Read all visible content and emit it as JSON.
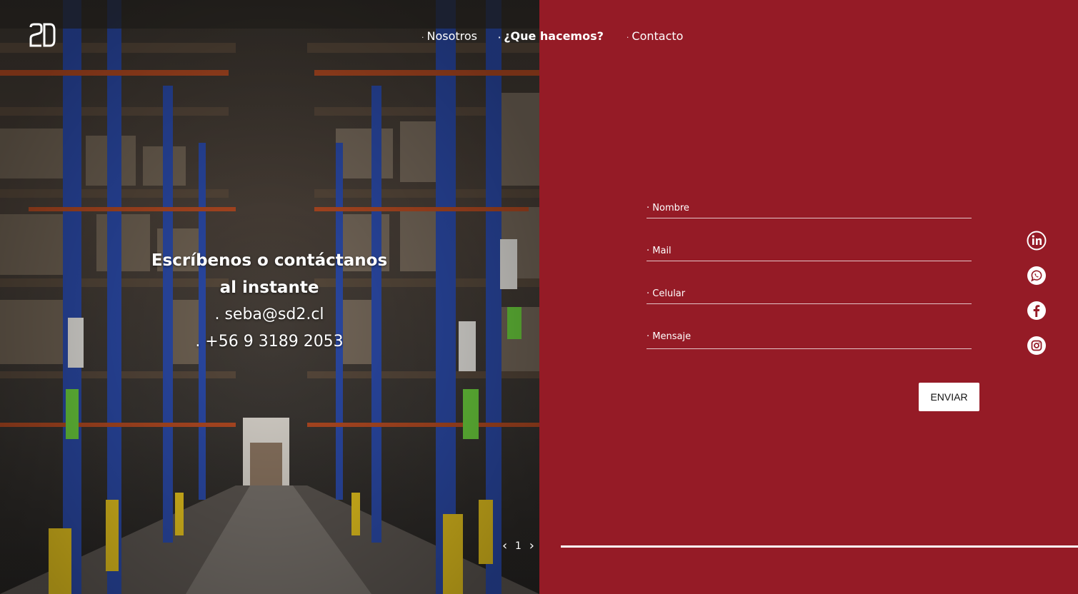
{
  "nav": {
    "items": [
      {
        "label": "Nosotros",
        "active": false
      },
      {
        "label": "¿Que hacemos?",
        "active": true
      },
      {
        "label": "Contacto",
        "active": false
      }
    ],
    "bullet": "·"
  },
  "contact": {
    "headline": "Escríbenos o contáctanos al instante",
    "email": ". seba@sd2.cl",
    "phone": ". +56 9 3189 2053"
  },
  "slider": {
    "current": "1"
  },
  "form": {
    "name_placeholder": "· Nombre",
    "mail_placeholder": "· Mail",
    "phone_placeholder": "· Celular",
    "message_placeholder": "· Mensaje",
    "submit_label": "ENVIAR"
  },
  "social": [
    "linkedin-icon",
    "whatsapp-icon",
    "facebook-icon",
    "instagram-icon"
  ],
  "colors": {
    "brand_red": "#951b26",
    "white": "#ffffff"
  }
}
